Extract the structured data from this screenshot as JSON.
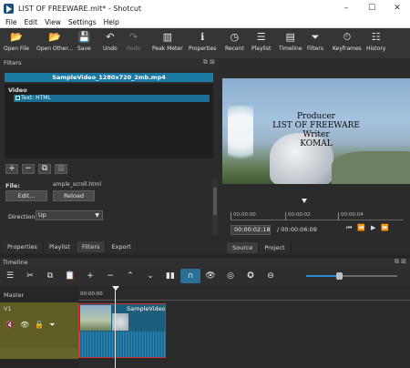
{
  "window": {
    "title": "LIST OF FREEWARE.mlt* - Shotcut",
    "minimize": "–",
    "maximize": "☐",
    "close": "✕"
  },
  "menu": [
    "File",
    "Edit",
    "View",
    "Settings",
    "Help"
  ],
  "toolbar": [
    {
      "label": "Open File",
      "icon": "open-folder-icon",
      "glyph": "📂",
      "enabled": true
    },
    {
      "label": "Open Other...",
      "icon": "open-other-icon",
      "glyph": "📂",
      "enabled": true
    },
    {
      "label": "Save",
      "icon": "save-icon",
      "glyph": "💾",
      "enabled": true
    },
    {
      "label": "Undo",
      "icon": "undo-icon",
      "glyph": "↶",
      "enabled": true
    },
    {
      "label": "Redo",
      "icon": "redo-icon",
      "glyph": "↷",
      "enabled": false
    },
    {
      "label": "Peak Meter",
      "icon": "peak-meter-icon",
      "glyph": "▥",
      "enabled": true
    },
    {
      "label": "Properties",
      "icon": "info-icon",
      "glyph": "ℹ",
      "enabled": true
    },
    {
      "label": "Recent",
      "icon": "clock-icon",
      "glyph": "◷",
      "enabled": true
    },
    {
      "label": "Playlist",
      "icon": "playlist-icon",
      "glyph": "☰",
      "enabled": true
    },
    {
      "label": "Timeline",
      "icon": "timeline-icon",
      "glyph": "▤",
      "enabled": true
    },
    {
      "label": "Filters",
      "icon": "filter-icon",
      "glyph": "⏷",
      "enabled": true
    },
    {
      "label": "Keyframes",
      "icon": "keyframes-icon",
      "glyph": "⏱",
      "enabled": true
    },
    {
      "label": "History",
      "icon": "history-icon",
      "glyph": "☷",
      "enabled": true
    }
  ],
  "filters_panel": {
    "header": "Filters",
    "header_controls": "⧉ ⊠",
    "clip_name": "SampleVideo_1280x720_2mb.mp4",
    "group": "Video",
    "filter_item": "Text: HTML",
    "buttons": [
      "+",
      "−",
      "⧉",
      "▦"
    ],
    "file_label": "File:",
    "file_name": "ample_scroll.html",
    "edit_label": "Edit...",
    "reload_label": "Reload",
    "direction_label": "Direction",
    "direction_value": "Up",
    "tabs": [
      "Properties",
      "Playlist",
      "Filters",
      "Export"
    ],
    "active_tab": "Filters"
  },
  "player": {
    "overlay_lines": [
      "Producer",
      "LIST OF FREEWARE",
      "Writer",
      "KOMAL"
    ],
    "ruler_ticks": [
      "00:00:00",
      "00:00:02",
      "00:00:04"
    ],
    "current_time": "00:00:02:18",
    "total_time": "/ 00:00:06:09",
    "transport": [
      "⏮",
      "⏪",
      "▶",
      "⏩"
    ],
    "tabs": [
      "Source",
      "Project"
    ],
    "active_tab": "Source"
  },
  "timeline": {
    "header": "Timeline",
    "header_controls": "⧉ ⊠",
    "tools": [
      {
        "name": "menu-icon",
        "glyph": "☰"
      },
      {
        "name": "cut-icon",
        "glyph": "✂"
      },
      {
        "name": "copy-icon",
        "glyph": "⧉"
      },
      {
        "name": "paste-icon",
        "glyph": "📋"
      },
      {
        "name": "append-icon",
        "glyph": "+"
      },
      {
        "name": "remove-icon",
        "glyph": "−"
      },
      {
        "name": "lift-icon",
        "glyph": "⌃"
      },
      {
        "name": "overwrite-icon",
        "glyph": "⌄"
      },
      {
        "name": "split-icon",
        "glyph": "▮▮"
      },
      {
        "name": "snap-icon",
        "glyph": "∩",
        "active": true
      },
      {
        "name": "scrub-icon",
        "glyph": "👁"
      },
      {
        "name": "ripple-icon",
        "glyph": "◎"
      },
      {
        "name": "ripple-all-icon",
        "glyph": "✪"
      },
      {
        "name": "zoom-out-icon",
        "glyph": "⊖"
      }
    ],
    "zoom_level": 0.36,
    "master_label": "Master",
    "track_name": "V1",
    "track_icons": [
      "🔇",
      "👁",
      "🔓",
      "⏷"
    ],
    "ruler_tick": "00:00:00",
    "clip_title": "SampleVideo"
  }
}
